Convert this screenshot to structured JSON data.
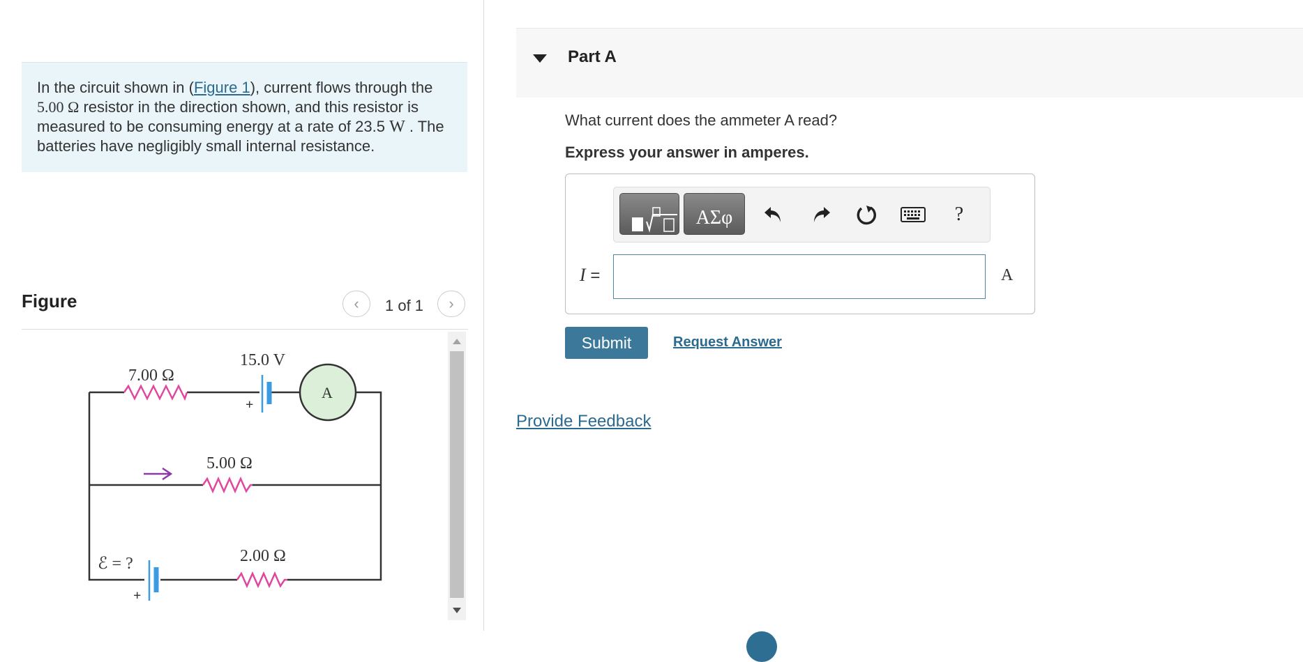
{
  "problem": {
    "intro": "In the circuit shown in (",
    "figure_link": "Figure 1",
    "rest_line1": "), current flows through the",
    "resistor_value": "5.00 Ω",
    "rest_line2": " resistor in the direction shown, and this resistor is measured to be consuming energy at a rate of 23.5 ",
    "power_unit": "W",
    "rest_line3": " . The batteries have negligibly small internal resistance."
  },
  "figure": {
    "title": "Figure",
    "counter": "1 of 1",
    "prev_glyph": "‹",
    "next_glyph": "›",
    "labels": {
      "r1": "7.00 Ω",
      "v1": "15.0 V",
      "ammeter": "A",
      "r2": "5.00 Ω",
      "emf": "ℰ = ?",
      "r3": "2.00 Ω",
      "plus": "+"
    }
  },
  "part": {
    "title": "Part A",
    "question": "What current does the ammeter A read?",
    "instruction": "Express your answer in amperes.",
    "variable": "I",
    "equals": " =",
    "unit": "A",
    "toolbar": {
      "templates_icon": "templates-icon",
      "greek_label": "ΑΣφ",
      "undo_icon": "undo-icon",
      "redo_icon": "redo-icon",
      "reset_icon": "reset-icon",
      "keyboard_icon": "keyboard-icon",
      "help_label": "?"
    },
    "submit_label": "Submit",
    "request_label": "Request Answer"
  },
  "feedback_label": "Provide Feedback",
  "colors": {
    "accent": "#3b7899",
    "link": "#2b6a8f",
    "resistor": "#e0479e",
    "battery": "#3a9be0",
    "arrow": "#8b3aa8",
    "ammeter_fill": "#dcefd8"
  }
}
